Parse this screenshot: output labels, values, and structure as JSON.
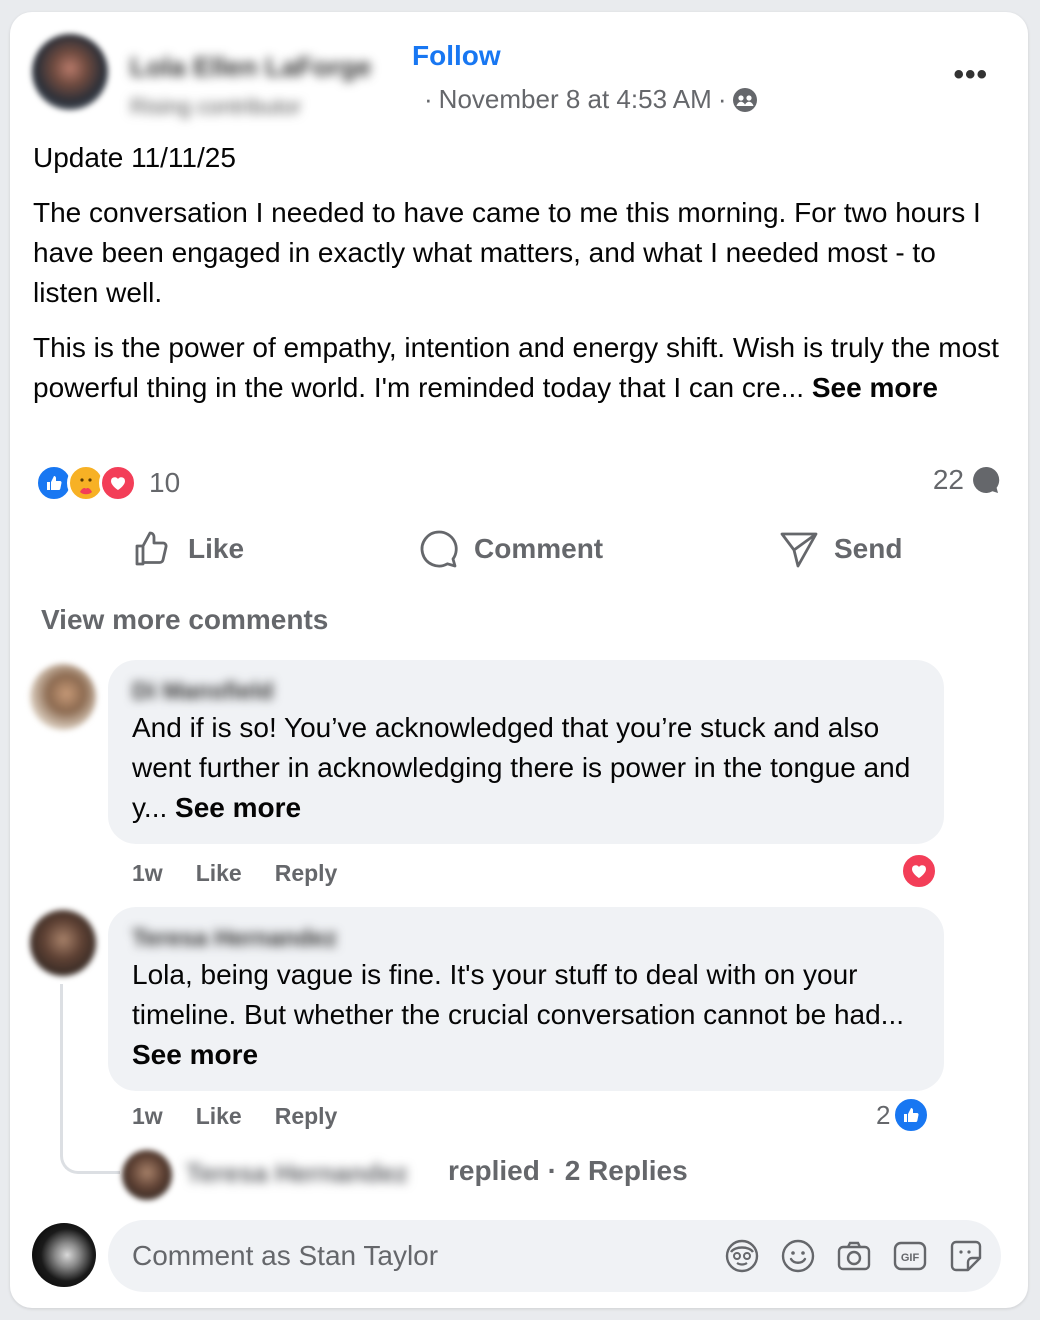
{
  "post": {
    "author_name": "Lola Ellen LaForge",
    "author_badge": "Rising contributor",
    "follow_label": "Follow",
    "timestamp": "November 8 at 4:53 AM",
    "separator": "·",
    "audience_icon": "friends-icon",
    "text_update": "Update 11/11/25",
    "text_p1": "The conversation I needed to have came to me this morning. For two hours I have been engaged in exactly what matters, and what I needed most - to listen well.",
    "text_p2": "This is the power of empathy, intention and energy shift. Wish is truly the most powerful thing in the world. I'm reminded today that I can cre...",
    "see_more_label": "See more",
    "reaction_count": "10",
    "comment_count": "22"
  },
  "actions": {
    "like_label": "Like",
    "comment_label": "Comment",
    "send_label": "Send"
  },
  "comments": {
    "view_more_label": "View more comments",
    "items": [
      {
        "author": "Di Mansfield",
        "text": "And if is so! You’ve acknowledged that you’re stuck and also went further in acknowledging there is power in the tongue and y...",
        "see_more": "See more",
        "time": "1w",
        "like_label": "Like",
        "reply_label": "Reply"
      },
      {
        "author": "Teresa Hernandez",
        "text": "Lola, being vague is fine. It's your stuff to deal with on your timeline. But whether the crucial conversation cannot be had...",
        "see_more": "See more",
        "time": "1w",
        "like_label": "Like",
        "reply_label": "Reply",
        "reaction_count": "2",
        "replied_name": "Teresa Hernandez",
        "replied_text": "replied · 2 Replies"
      }
    ]
  },
  "composer": {
    "placeholder": "Comment as Stan Taylor"
  },
  "colors": {
    "accent": "#1877f2",
    "love": "#f33e58",
    "muted": "#65676b",
    "bubble": "#f0f2f5"
  }
}
